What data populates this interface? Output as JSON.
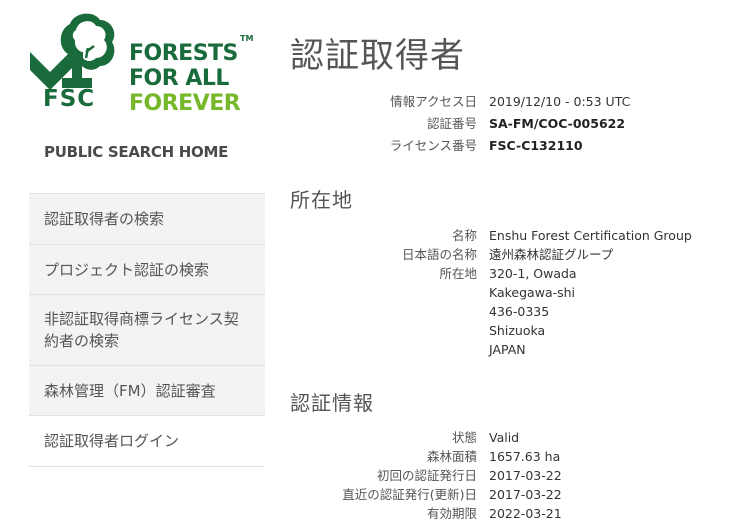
{
  "logo": {
    "fsc": "FSC",
    "tagline": [
      "FORESTS",
      "FOR ALL",
      "FOREVER"
    ],
    "tm": "TM",
    "colors": {
      "dark": "#1a6b3c",
      "light": "#77b82a"
    }
  },
  "sidebar": {
    "home_label": "PUBLIC SEARCH HOME",
    "items": [
      {
        "label": "認証取得者の検索"
      },
      {
        "label": "プロジェクト認証の検索"
      },
      {
        "label": "非認証取得商標ライセンス契約者の検索"
      },
      {
        "label": "森林管理（FM）認証審査"
      },
      {
        "label": "認証取得者ログイン"
      }
    ]
  },
  "main": {
    "title": "認証取得者",
    "info": [
      {
        "key": "情報アクセス日",
        "value": "2019/12/10 - 0:53 UTC"
      },
      {
        "key": "認証番号",
        "value": "SA-FM/COC-005622"
      },
      {
        "key": "ライセンス番号",
        "value": "FSC-C132110"
      }
    ],
    "address": {
      "title": "所在地",
      "rows": [
        {
          "key": "名称",
          "value": "Enshu Forest Certification Group"
        },
        {
          "key": "日本語の名称",
          "value": "遠州森林認証グループ"
        },
        {
          "key": "所在地",
          "value": "320-1, Owada"
        },
        {
          "key": "",
          "value": "Kakegawa-shi"
        },
        {
          "key": "",
          "value": "436-0335"
        },
        {
          "key": "",
          "value": "Shizuoka"
        },
        {
          "key": "",
          "value": "JAPAN"
        }
      ]
    },
    "cert": {
      "title": "認証情報",
      "rows": [
        {
          "key": "状態",
          "value": "Valid"
        },
        {
          "key": "森林面積",
          "value": "1657.63 ha"
        },
        {
          "key": "初回の認証発行日",
          "value": "2017-03-22"
        },
        {
          "key": "直近の認証発行(更新)日",
          "value": "2017-03-22"
        },
        {
          "key": "有効期限",
          "value": "2022-03-21"
        }
      ]
    }
  }
}
